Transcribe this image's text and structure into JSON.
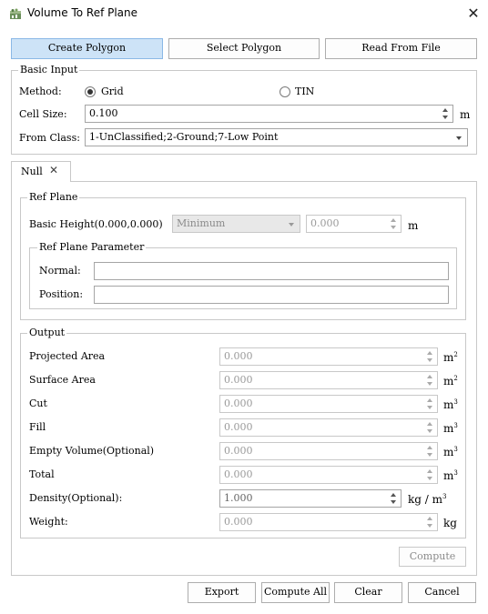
{
  "window": {
    "title": "Volume To Ref Plane",
    "icon": "app-icon",
    "close_icon": "close-icon"
  },
  "toolbar": {
    "create_polygon": "Create Polygon",
    "select_polygon": "Select Polygon",
    "read_from_file": "Read From File"
  },
  "basic_input": {
    "legend": "Basic Input",
    "method_label": "Method:",
    "method_grid": "Grid",
    "method_tin": "TIN",
    "method_selected": "Grid",
    "cell_size_label": "Cell Size:",
    "cell_size_value": "0.100",
    "cell_size_unit": "m",
    "from_class_label": "From Class:",
    "from_class_value": "1-UnClassified;2-Ground;7-Low Point"
  },
  "tabs": [
    {
      "label": "Null",
      "close_icon": "close-icon"
    }
  ],
  "ref_plane": {
    "legend": "Ref Plane",
    "basic_height_label": "Basic Height(0.000,0.000)",
    "mode_value": "Minimum",
    "height_value": "0.000",
    "height_unit": "m",
    "param_legend": "Ref Plane Parameter",
    "normal_label": "Normal:",
    "normal_value": "",
    "position_label": "Position:",
    "position_value": ""
  },
  "output": {
    "legend": "Output",
    "rows": [
      {
        "label": "Projected Area",
        "value": "0.000",
        "unit": "m",
        "sup": "2"
      },
      {
        "label": "Surface Area",
        "value": "0.000",
        "unit": "m",
        "sup": "2"
      },
      {
        "label": "Cut",
        "value": "0.000",
        "unit": "m",
        "sup": "3"
      },
      {
        "label": "Fill",
        "value": "0.000",
        "unit": "m",
        "sup": "3"
      },
      {
        "label": "Empty Volume(Optional)",
        "value": "0.000",
        "unit": "m",
        "sup": "3"
      },
      {
        "label": "Total",
        "value": "0.000",
        "unit": "m",
        "sup": "3"
      },
      {
        "label": "Density(Optional):",
        "value": "1.000",
        "unit": "kg / m",
        "sup": "3"
      },
      {
        "label": "Weight:",
        "value": "0.000",
        "unit": "kg",
        "sup": ""
      }
    ],
    "compute_label": "Compute"
  },
  "footer": {
    "export": "Export",
    "compute_all": "Compute All",
    "clear": "Clear",
    "cancel": "Cancel"
  }
}
